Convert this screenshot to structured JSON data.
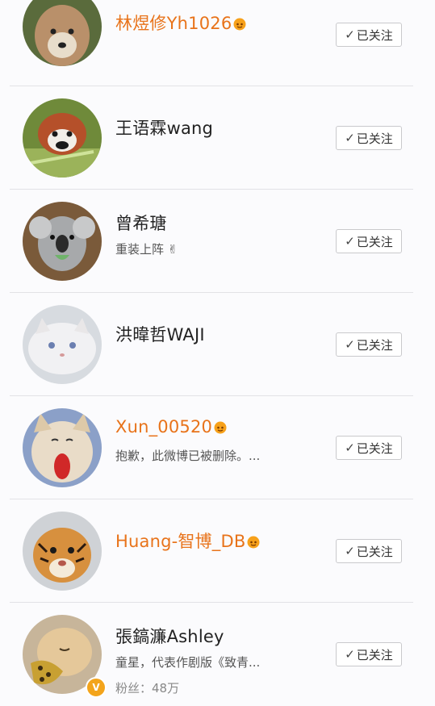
{
  "follow_label": "已关注",
  "follow_check": "✓",
  "colors": {
    "vip_name": "#e8731a",
    "verified_badge": "#f3a41b"
  },
  "users": [
    {
      "name": "林煜修Yh1026",
      "vip": true,
      "avatar_icon": "wolf-pup-avatar"
    },
    {
      "name": "王语霖wang",
      "vip": false,
      "avatar_icon": "red-panda-avatar"
    },
    {
      "name": "曾希瑭",
      "vip": false,
      "desc": "重装上阵 ✌",
      "avatar_icon": "koala-avatar"
    },
    {
      "name": "洪暐哲WAJI",
      "vip": false,
      "avatar_icon": "white-cat-avatar"
    },
    {
      "name": "Xun_00520",
      "vip": true,
      "desc": "抱歉，此微博已被删除。...",
      "avatar_icon": "fox-yawning-avatar"
    },
    {
      "name": "Huang-智博_DB",
      "vip": true,
      "avatar_icon": "tiger-cub-avatar"
    },
    {
      "name": "張鎬濂Ashley",
      "vip": false,
      "verified": true,
      "desc": "童星，代表作剧版《致青...",
      "fans": "粉丝：48万",
      "avatar_icon": "puppy-avatar"
    }
  ]
}
